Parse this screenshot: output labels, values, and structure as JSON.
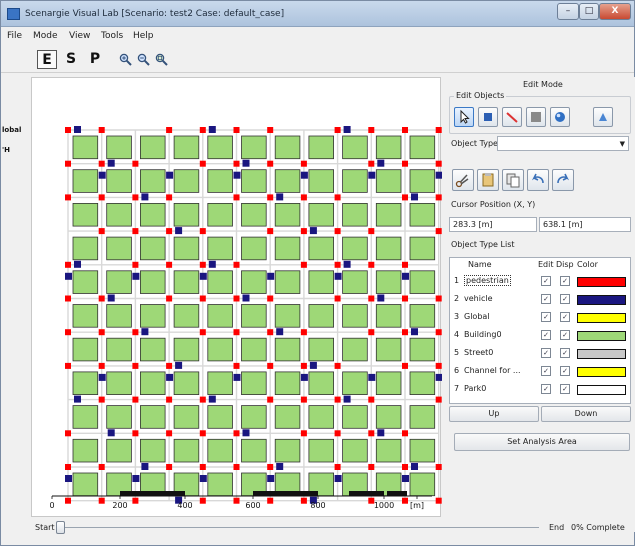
{
  "window": {
    "title": "Scenargie Visual Lab [Scenario: test2 Case: default_case]",
    "controls": {
      "minimize": "–",
      "maximize": "□",
      "close": "X"
    }
  },
  "menu": [
    "File",
    "Mode",
    "View",
    "Tools",
    "Help"
  ],
  "toolbar": {
    "modes": [
      "E",
      "S",
      "P"
    ],
    "active_mode": "E",
    "zoom_icons": [
      "zoom-in-icon",
      "zoom-out-icon",
      "zoom-fit-icon"
    ]
  },
  "canvas": {
    "side_labels": [
      "lobal",
      "'H"
    ],
    "scale_ticks": [
      "0",
      "200",
      "400",
      "600",
      "800",
      "1000",
      "[m]"
    ]
  },
  "panel": {
    "mode_title": "Edit Mode",
    "edit_objects_label": "Edit Objects",
    "object_type_label": "Object Type",
    "object_type_value": "",
    "cursor_label": "Cursor Position (X, Y)",
    "cursor_x": "283.3 [m]",
    "cursor_y": "638.1 [m]",
    "list_label": "Object Type List",
    "columns": {
      "name": "Name",
      "edit": "Edit",
      "disp": "Disp",
      "color": "Color"
    },
    "rows": [
      {
        "num": "1",
        "name": "pedestrian",
        "edit": true,
        "disp": true,
        "color": "#ff0000",
        "selected": true
      },
      {
        "num": "2",
        "name": "vehicle",
        "edit": true,
        "disp": true,
        "color": "#1a1680"
      },
      {
        "num": "3",
        "name": "Global",
        "edit": true,
        "disp": true,
        "color": "#ffff00"
      },
      {
        "num": "4",
        "name": "Building0",
        "edit": true,
        "disp": true,
        "color": "#9ed877"
      },
      {
        "num": "5",
        "name": "Street0",
        "edit": true,
        "disp": true,
        "color": "#c8c8c8"
      },
      {
        "num": "6",
        "name": "Channel for ...",
        "edit": true,
        "disp": true,
        "color": "#ffff00"
      },
      {
        "num": "7",
        "name": "Park0",
        "edit": true,
        "disp": true,
        "color": "#ffffff"
      }
    ],
    "up_label": "Up",
    "down_label": "Down",
    "analysis_button": "Set Analysis Area"
  },
  "status": {
    "start": "Start",
    "end": "End",
    "complete": "0% Complete"
  },
  "colors": {
    "building": "#9ed877",
    "pedestrian": "#ff0000",
    "vehicle": "#1a1680",
    "street": "#d8d8d8"
  }
}
